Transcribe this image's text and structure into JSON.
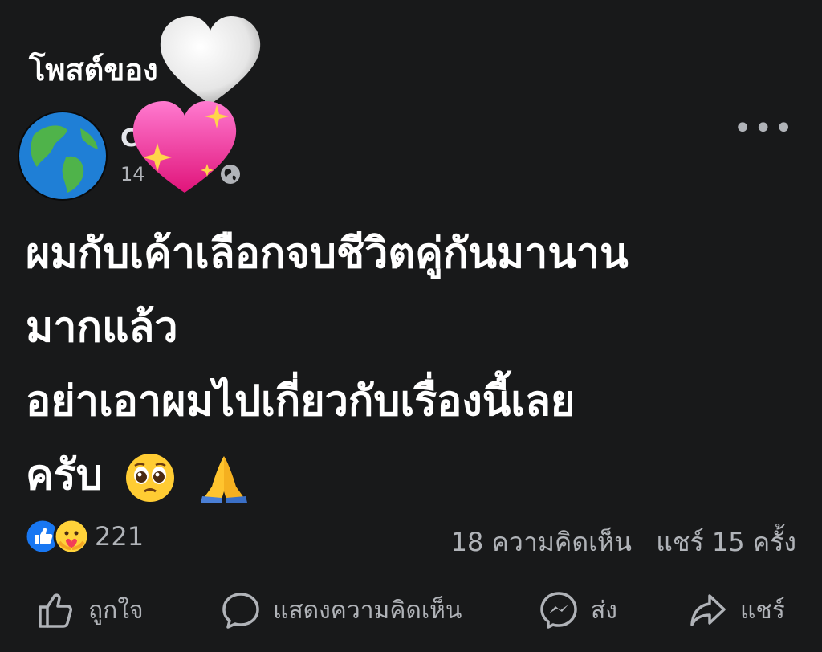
{
  "header": {
    "title": "โพสต์ของ"
  },
  "post": {
    "author_name": "C",
    "timestamp": "14",
    "privacy_icon": "globe-icon",
    "body_lines": [
      "ผมกับเค้าเลือกจบชีวิตคู่กันมานาน",
      "มากแล้ว",
      "อย่าเอาผมไปเกี่ยวกับเรื่องนี้เลย",
      "ครับ"
    ],
    "body_emojis": [
      "pleading-face-icon",
      "folded-hands-icon"
    ]
  },
  "engagement": {
    "reaction_count": "221",
    "comments": "18 ความคิดเห็น",
    "shares": "แชร์ 15 ครั้ง"
  },
  "actions": {
    "like": "ถูกใจ",
    "comment": "แสดงความคิดเห็น",
    "send": "ส่ง",
    "share": "แชร์"
  },
  "colors": {
    "background": "#18191a",
    "text_primary": "#ffffff",
    "text_secondary": "#b0b3b8",
    "like_blue": "#1877f2"
  }
}
